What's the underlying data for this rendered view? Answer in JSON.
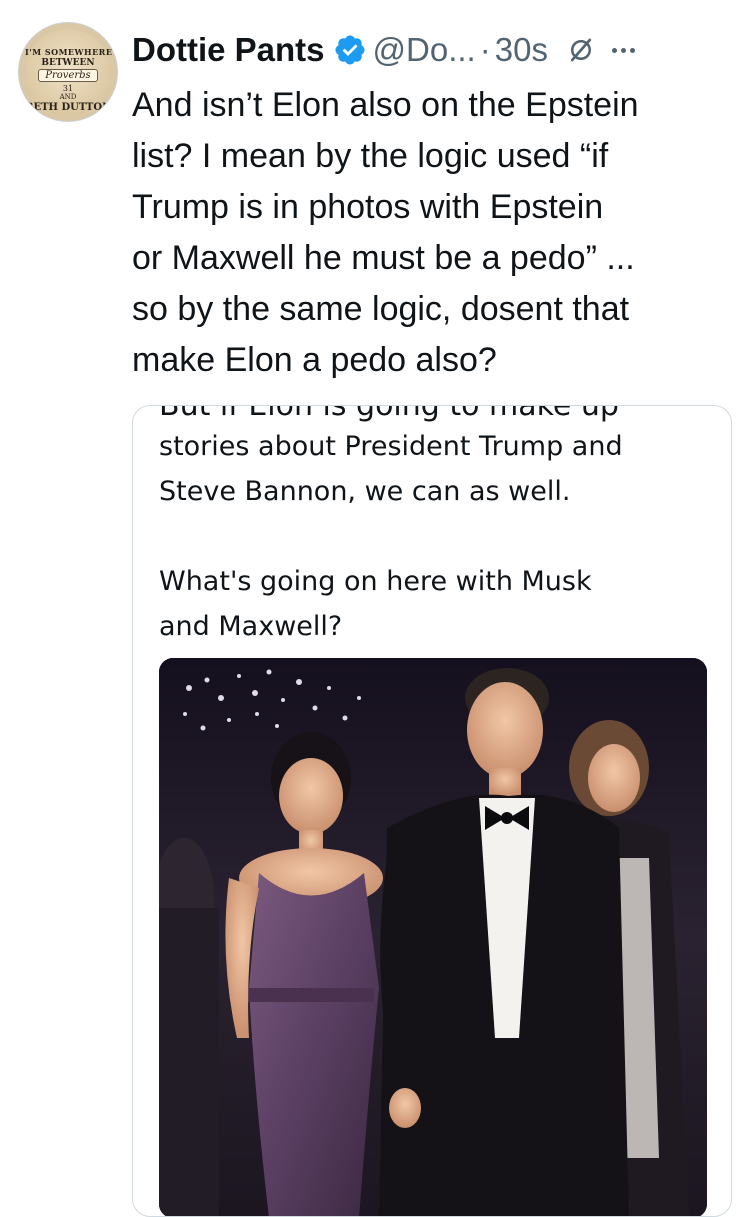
{
  "avatar": {
    "lines": [
      "I'M SOMEWHERE",
      "BETWEEN",
      "Proverbs",
      "31",
      "AND",
      "BETH DUTTON"
    ]
  },
  "tweet": {
    "author_name": "Dottie Pants",
    "handle": "@Do...",
    "separator": "·",
    "time": "30s",
    "text_lines": [
      "And isn’t Elon also on the Epstein",
      "list? I mean by the logic used “if",
      "Trump is in photos with Epstein",
      "or Maxwell he must be a pedo” ...",
      "so by the same logic, dosent that",
      "make Elon a pedo also?"
    ]
  },
  "quote": {
    "cut_line": "But if Elon is going to make up",
    "lines": [
      "stories about President Trump and",
      "Steve Bannon, we can as well."
    ],
    "lines2": [
      "What's going on here with Musk",
      "and Maxwell?"
    ]
  },
  "colors": {
    "verified": "#1d9bf0",
    "muted_text": "#536471",
    "border": "#cfd9de"
  },
  "icons": [
    "verified-badge-icon",
    "grok-icon",
    "more-icon"
  ]
}
